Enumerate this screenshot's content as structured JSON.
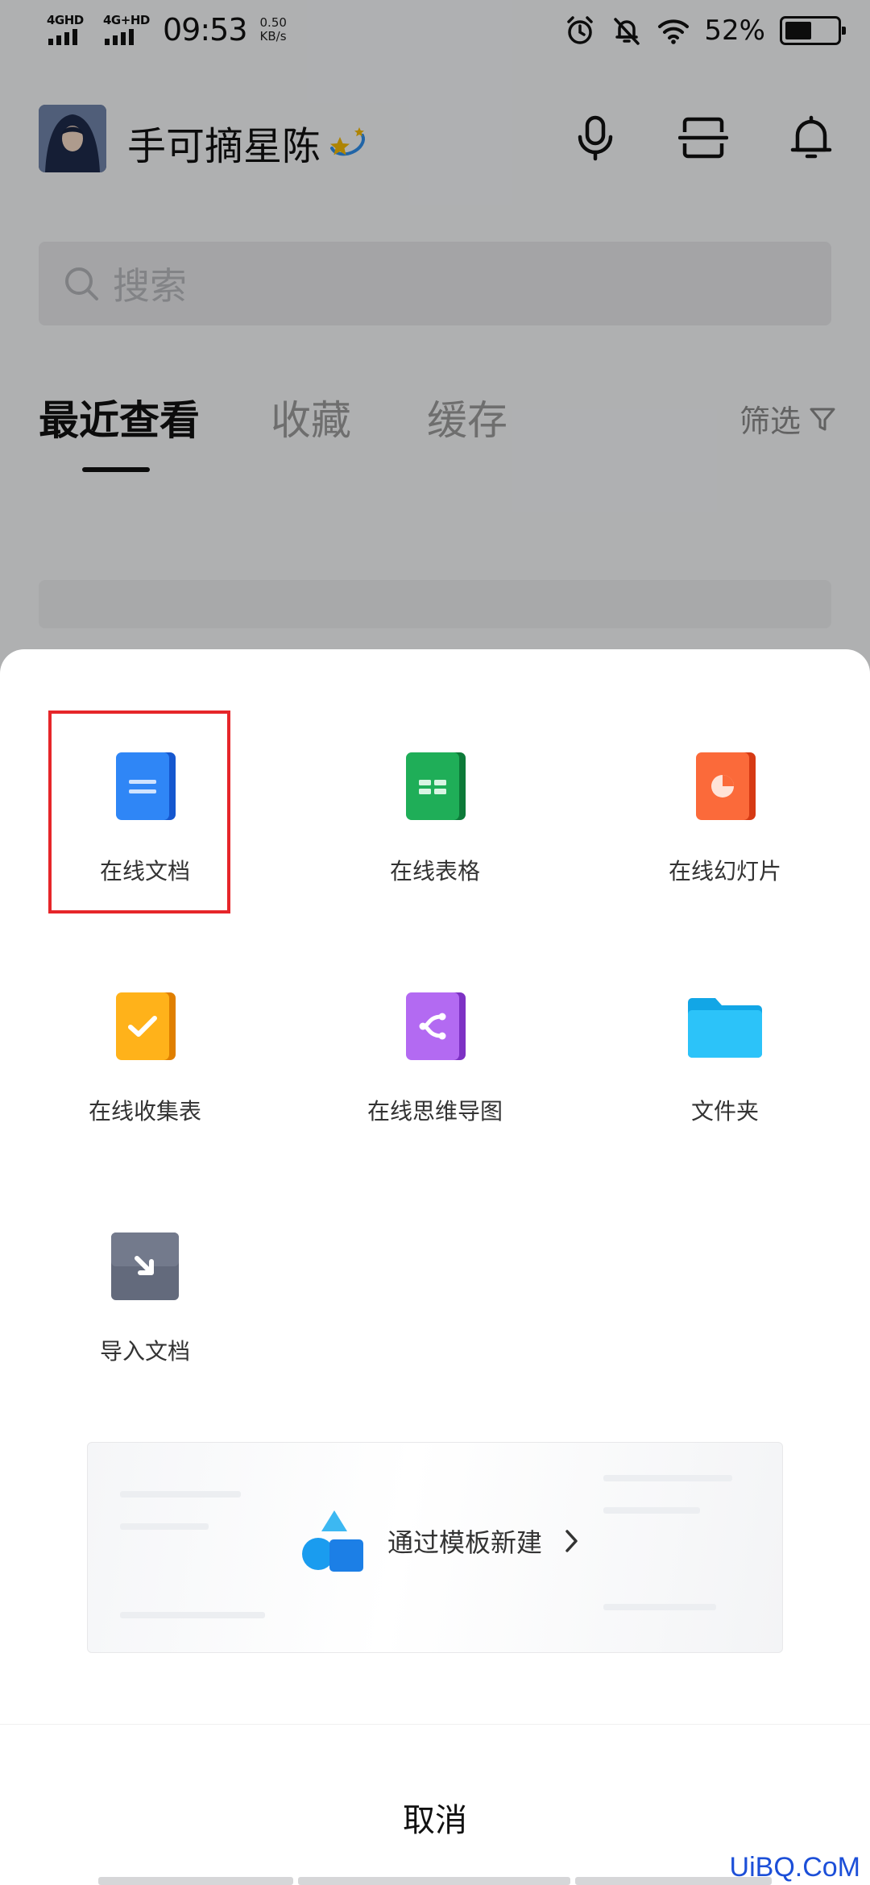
{
  "status_bar": {
    "network_1": "4GHD",
    "network_2": "4G+HD",
    "time": "09:53",
    "speed_value": "0.50",
    "speed_unit": "KB/s",
    "battery_pct": "52%",
    "battery_level": 0.52,
    "icons": [
      "alarm-icon",
      "mute-icon",
      "wifi-icon",
      "battery-icon"
    ]
  },
  "header": {
    "username": "手可摘星陈",
    "icons": [
      "microphone-icon",
      "scan-icon",
      "bell-icon"
    ]
  },
  "search": {
    "placeholder": "搜索"
  },
  "tabs": {
    "items": [
      {
        "label": "最近查看",
        "active": true
      },
      {
        "label": "收藏",
        "active": false
      },
      {
        "label": "缓存",
        "active": false
      }
    ],
    "filter_label": "筛选"
  },
  "sheet": {
    "items": [
      {
        "label": "在线文档",
        "icon": "doc-icon",
        "color": "#1e6ff0"
      },
      {
        "label": "在线表格",
        "icon": "sheet-icon",
        "color": "#17a34a"
      },
      {
        "label": "在线幻灯片",
        "icon": "slides-icon",
        "color": "#f05a2c"
      },
      {
        "label": "在线收集表",
        "icon": "form-icon",
        "color": "#f5a300"
      },
      {
        "label": "在线思维导图",
        "icon": "mindmap-icon",
        "color": "#a04fe0"
      },
      {
        "label": "文件夹",
        "icon": "folder-icon",
        "color": "#1bb4f5"
      },
      {
        "label": "导入文档",
        "icon": "import-icon",
        "color": "#5b6274"
      }
    ],
    "template_label": "通过模板新建",
    "cancel_label": "取消",
    "highlight_color": "#e6262a"
  },
  "watermark": "UiBQ.CoM"
}
